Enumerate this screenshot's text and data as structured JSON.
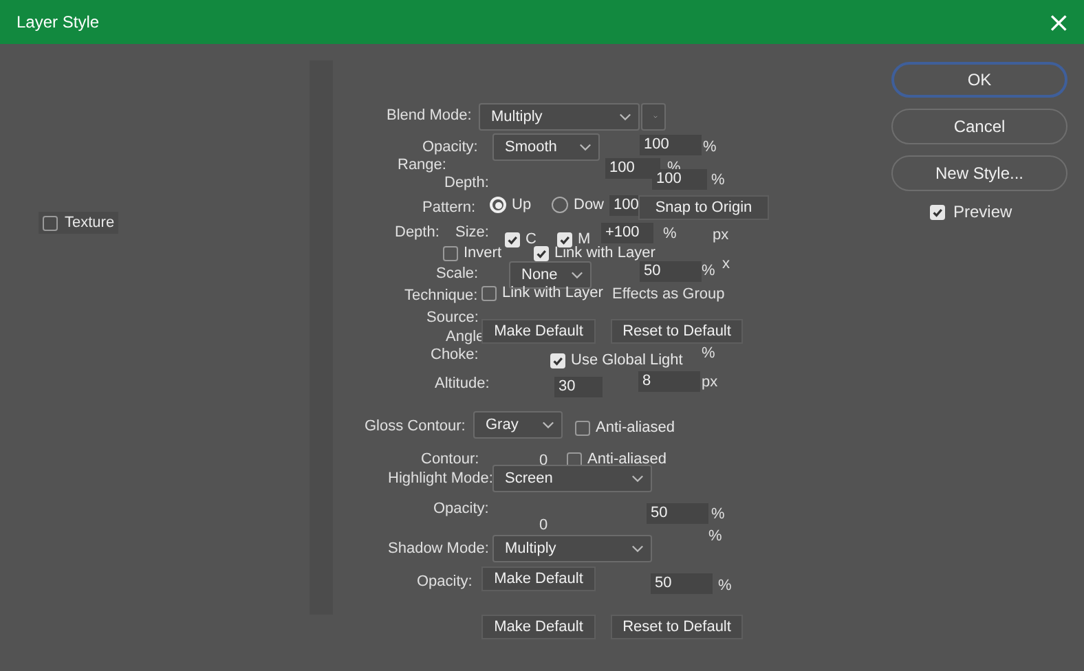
{
  "window": {
    "title": "Layer Style",
    "close": "×"
  },
  "sidebar": {
    "items": [
      {
        "label": "Texture",
        "checked": false
      }
    ]
  },
  "panel": {
    "items": [
      {
        "kind": "label",
        "text": "Blend Mode:"
      },
      {
        "kind": "select",
        "text": "Multiply"
      },
      {
        "kind": "select"
      },
      {
        "kind": "label",
        "text": "Opacity:"
      },
      {
        "kind": "select",
        "text": "Smooth"
      },
      {
        "kind": "field",
        "text": "100"
      },
      {
        "kind": "label",
        "text": "%"
      },
      {
        "kind": "label",
        "text": "Range:"
      },
      {
        "kind": "field",
        "text": "100"
      },
      {
        "kind": "label",
        "text": "%"
      },
      {
        "kind": "label",
        "text": "Depth:"
      },
      {
        "kind": "field",
        "text": "100"
      },
      {
        "kind": "label",
        "text": "%"
      },
      {
        "kind": "label",
        "text": "Pattern:"
      },
      {
        "kind": "radio",
        "text": "Up",
        "selected": true
      },
      {
        "kind": "radio",
        "text": "Dow",
        "selected": false
      },
      {
        "kind": "field",
        "text": "100"
      },
      {
        "kind": "button",
        "text": "Snap to Origin"
      },
      {
        "kind": "label",
        "text": "Depth:"
      },
      {
        "kind": "label",
        "text": "Size:"
      },
      {
        "kind": "checkbox",
        "text": "C",
        "checked": true
      },
      {
        "kind": "checkbox",
        "text": "M",
        "checked": true
      },
      {
        "kind": "field",
        "text": "+100"
      },
      {
        "kind": "label",
        "text": "%"
      },
      {
        "kind": "label",
        "text": "px"
      },
      {
        "kind": "checkbox",
        "text": "Invert",
        "checked": false
      },
      {
        "kind": "checkbox",
        "text": "Link with Layer",
        "checked": true
      },
      {
        "kind": "label",
        "text": "Scale:"
      },
      {
        "kind": "select",
        "text": "None"
      },
      {
        "kind": "field",
        "text": "50"
      },
      {
        "kind": "label",
        "text": "%"
      },
      {
        "kind": "label",
        "text": "x"
      },
      {
        "kind": "label",
        "text": "Technique:"
      },
      {
        "kind": "checkbox",
        "text": "Link with Layer",
        "checked": false
      },
      {
        "kind": "label",
        "text": "Effects as Group"
      },
      {
        "kind": "label",
        "text": "Source:"
      },
      {
        "kind": "label",
        "text": "Angle"
      },
      {
        "kind": "button",
        "text": "Make Default"
      },
      {
        "kind": "button",
        "text": "Reset to Default"
      },
      {
        "kind": "label",
        "text": "Choke:"
      },
      {
        "kind": "label",
        "text": "%"
      },
      {
        "kind": "checkbox",
        "text": "Use Global Light",
        "checked": true
      },
      {
        "kind": "label",
        "text": "Altitude:"
      },
      {
        "kind": "field",
        "text": "30"
      },
      {
        "kind": "field",
        "text": "8"
      },
      {
        "kind": "label",
        "text": "px"
      },
      {
        "kind": "label",
        "text": "Gloss Contour:"
      },
      {
        "kind": "select",
        "text": "Gray"
      },
      {
        "kind": "checkbox",
        "text": "Anti-aliased",
        "checked": false
      },
      {
        "kind": "label",
        "text": "Contour:"
      },
      {
        "kind": "label",
        "text": "0"
      },
      {
        "kind": "checkbox",
        "text": "Anti-aliased",
        "checked": false
      },
      {
        "kind": "label",
        "text": "Highlight Mode:"
      },
      {
        "kind": "select",
        "text": "Screen"
      },
      {
        "kind": "label",
        "text": "Opacity:"
      },
      {
        "kind": "field",
        "text": "50"
      },
      {
        "kind": "label",
        "text": "%"
      },
      {
        "kind": "label",
        "text": "0"
      },
      {
        "kind": "label",
        "text": "%"
      },
      {
        "kind": "label",
        "text": "Shadow Mode:"
      },
      {
        "kind": "select",
        "text": "Multiply"
      },
      {
        "kind": "label",
        "text": "Opacity:"
      },
      {
        "kind": "button",
        "text": "Make Default"
      },
      {
        "kind": "field",
        "text": "50"
      },
      {
        "kind": "label",
        "text": "%"
      },
      {
        "kind": "button",
        "text": "Make Default"
      },
      {
        "kind": "button",
        "text": "Reset to Default"
      }
    ]
  },
  "buttons": [
    {
      "label": "OK",
      "focused": true
    },
    {
      "label": "Cancel",
      "focused": false
    },
    {
      "label": "New Style...",
      "focused": false
    }
  ],
  "preview": {
    "label": "Preview",
    "checked": true
  }
}
